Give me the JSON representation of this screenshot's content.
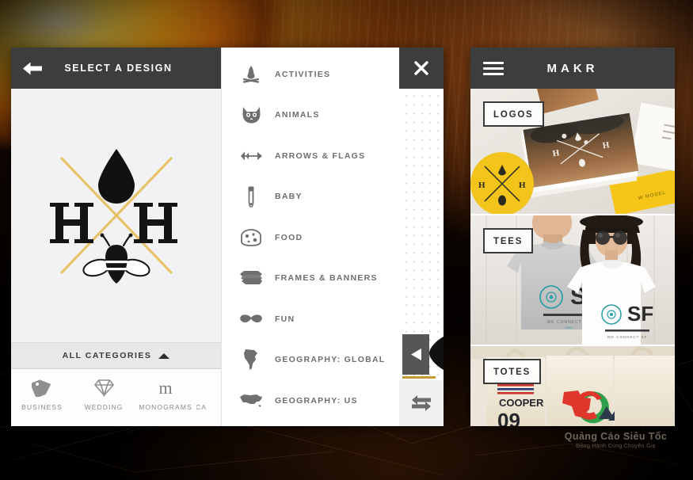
{
  "background": {
    "description": "fiery orange sunburst over dark textured backdrop",
    "colors": {
      "flare_core": "#fff6c9",
      "flare_mid": "#ffaa15",
      "flare_edge": "#8a3a04",
      "right_glow": "#a8541c",
      "base_dark": "#000000"
    }
  },
  "left_screen": {
    "topbar": {
      "back_icon": "arrow-left-icon",
      "title": "SELECT A DESIGN"
    },
    "design": {
      "monogram_left": "H",
      "monogram_right": "H",
      "top_motif": "water-drop-icon",
      "bottom_motif": "bee-icon",
      "cross_color": "#e3c05c",
      "ink_color": "#121212",
      "canvas_color": "#f2f2f4"
    },
    "all_categories": {
      "label": "ALL CATEGORIES",
      "caret_icon": "caret-up-icon"
    },
    "category_strip": [
      {
        "label": "BUSINESS",
        "icon": "tag-icon"
      },
      {
        "label": "WEDDING",
        "icon": "diamond-icon"
      },
      {
        "label": "MONOGRAMS",
        "icon": "letter-m-icon"
      },
      {
        "label": "CA",
        "icon": "clipped-icon"
      }
    ]
  },
  "category_list": {
    "items": [
      {
        "label": "ACTIVITIES",
        "icon": "campfire-icon"
      },
      {
        "label": "ANIMALS",
        "icon": "cat-face-icon"
      },
      {
        "label": "ARROWS & FLAGS",
        "icon": "arrow-icon"
      },
      {
        "label": "BABY",
        "icon": "safety-pin-icon"
      },
      {
        "label": "FOOD",
        "icon": "cheese-icon"
      },
      {
        "label": "FRAMES & BANNERS",
        "icon": "banner-icon"
      },
      {
        "label": "FUN",
        "icon": "mustache-icon"
      },
      {
        "label": "GEOGRAPHY: GLOBAL",
        "icon": "south-america-map-icon"
      },
      {
        "label": "GEOGRAPHY: US",
        "icon": "usa-map-icon"
      },
      {
        "label": "",
        "icon": "partial-icon"
      }
    ],
    "rail": {
      "close_icon": "close-x-icon",
      "prev_icon": "triangle-left-icon",
      "swap_icon": "swap-arrows-icon",
      "dotgrid": "dotted-background"
    }
  },
  "right_screen": {
    "header": {
      "menu_icon": "hamburger-menu-icon",
      "brand": "MAKR"
    },
    "tiles": [
      {
        "label": "LOGOS",
        "art": "business-cards-and-yellow-sticker-photo"
      },
      {
        "label": "TEES",
        "art": "couple-wearing-sf-tees-photo"
      },
      {
        "label": "TOTES",
        "art": "canvas-tote-bags-photo"
      }
    ]
  },
  "watermark": {
    "line1": "Quảng Cáo Siêu Tốc",
    "line2": "Đồng Hành Cùng Chuyên Gia"
  }
}
